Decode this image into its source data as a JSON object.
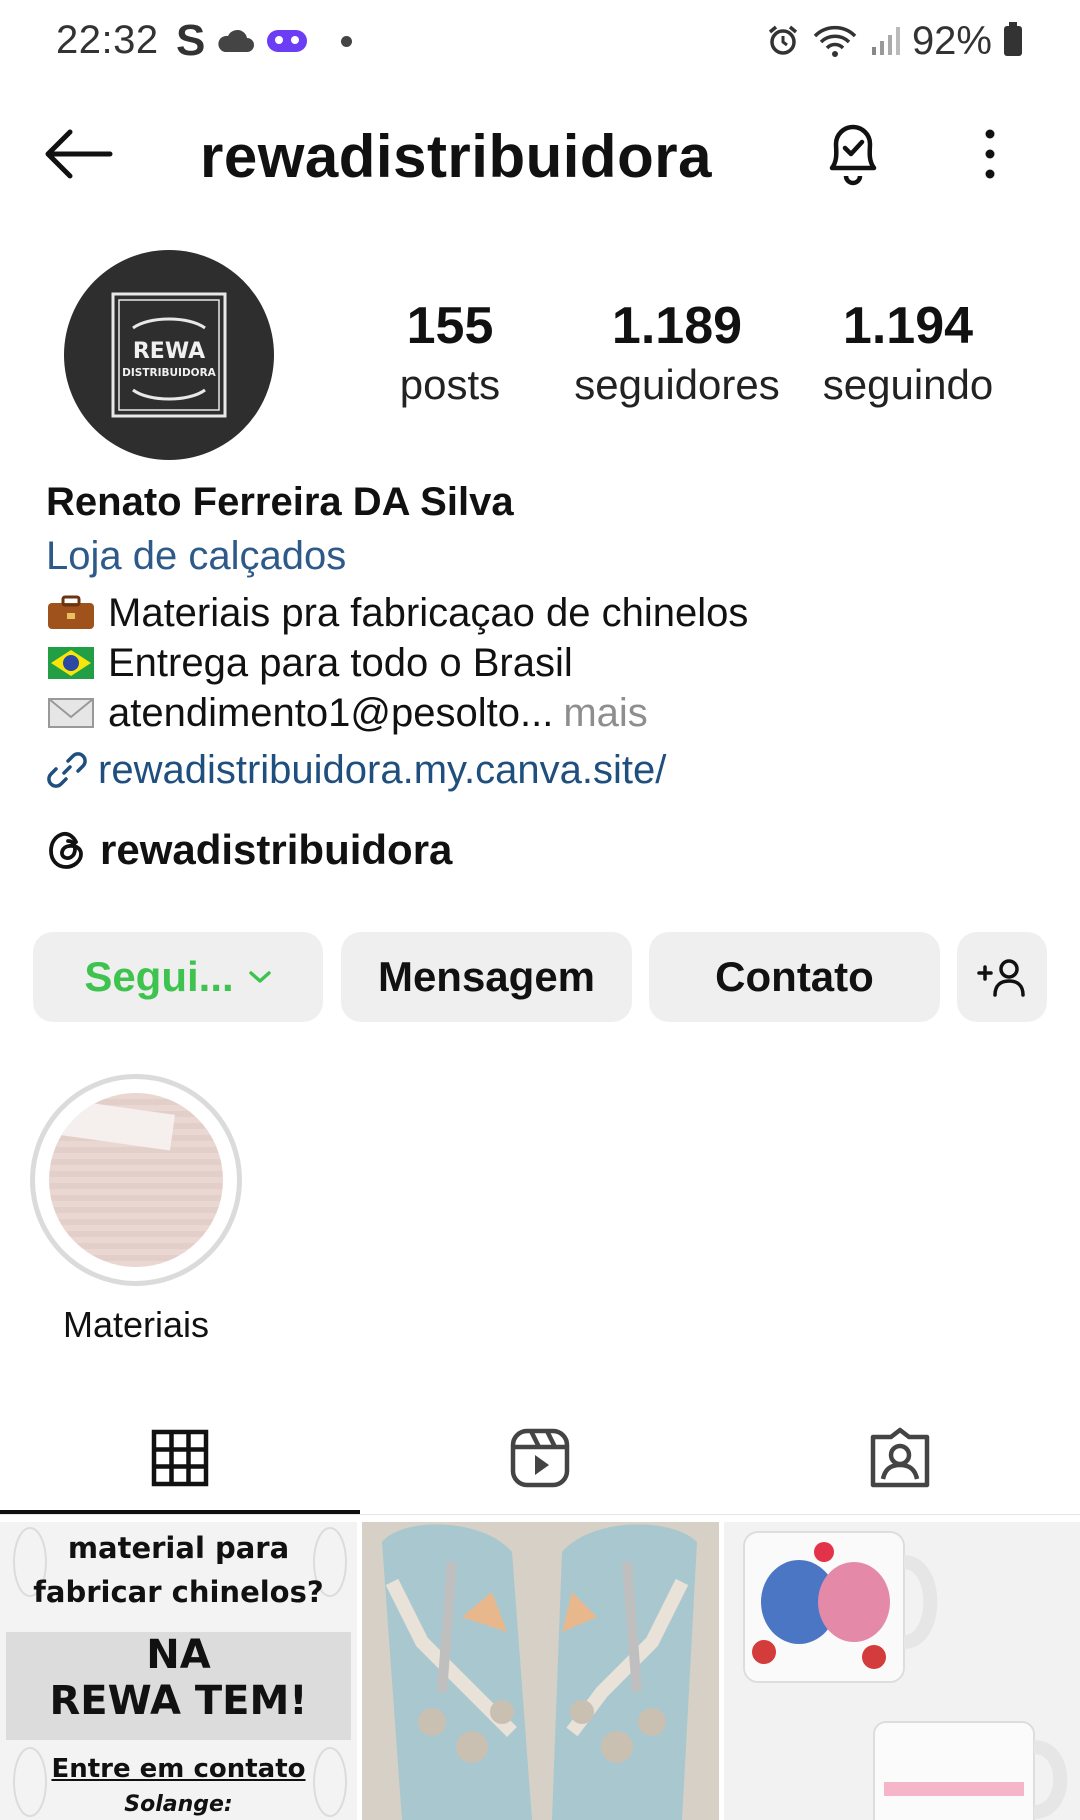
{
  "status_bar": {
    "time": "22:32",
    "s_icon": "S",
    "battery": "92%",
    "icons": [
      "cloud-icon",
      "game-controller-icon",
      "notification-dot",
      "alarm-icon",
      "wifi-icon",
      "signal-icon",
      "battery-icon"
    ]
  },
  "header": {
    "username": "rewadistribuidora",
    "icons": [
      "back-arrow-icon",
      "notification-bell-icon",
      "more-options-icon"
    ]
  },
  "profile": {
    "avatar_text_main": "REWA",
    "avatar_text_sub": "DISTRIBUIDORA",
    "stats": {
      "posts_value": "155",
      "posts_label": "posts",
      "followers_value": "1.189",
      "followers_label": "seguidores",
      "following_value": "1.194",
      "following_label": "seguindo"
    }
  },
  "bio": {
    "name": "Renato Ferreira DA Silva",
    "category": "Loja de calçados",
    "lines": [
      "Materiais pra fabricaçao de chinelos",
      "Entrega para todo o Brasil",
      "atendimento1@pesolto..."
    ],
    "more": "mais",
    "link": "rewadistribuidora.my.canva.site/",
    "threads_handle": "rewadistribuidora"
  },
  "actions": {
    "follow": "Segui...",
    "message": "Mensagem",
    "contact": "Contato"
  },
  "highlights": [
    {
      "label": "Materiais"
    }
  ],
  "tabs": [
    "grid-icon",
    "reels-icon",
    "tagged-icon"
  ],
  "posts": {
    "post1": {
      "line1": "material para",
      "line2": "fabricar chinelos?",
      "line3": "NA",
      "line4": "REWA TEM!",
      "line5": "Entre em contato",
      "line6": "Solange:"
    }
  },
  "colors": {
    "follow_green": "#3fc34f",
    "category_blue": "#2d5a88",
    "link_blue": "#1f4f7e",
    "button_bg": "#efefef"
  }
}
